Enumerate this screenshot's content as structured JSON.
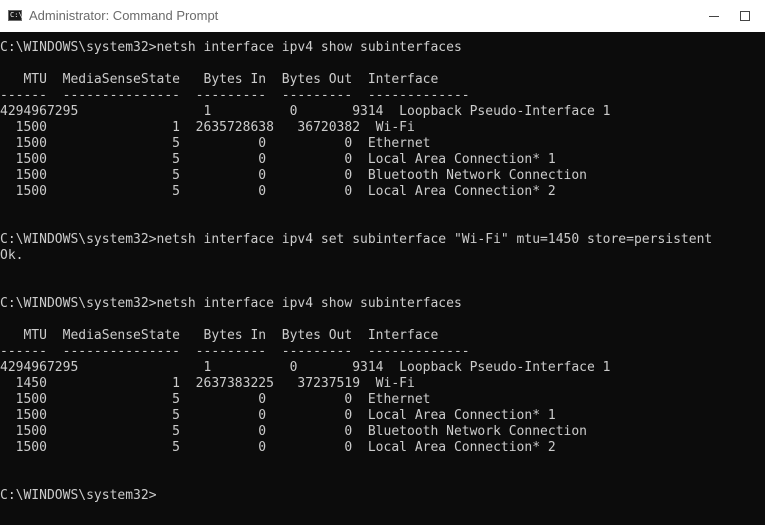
{
  "window": {
    "title": "Administrator: Command Prompt",
    "icon": "cmd-icon",
    "icon_glyph": "C:\\"
  },
  "colors": {
    "console_background": "#0c0c0c",
    "console_text": "#cccccc",
    "titlebar_background": "#ffffff",
    "title_text": "#6b6b6b"
  },
  "console": {
    "lines": [
      "C:\\WINDOWS\\system32>netsh interface ipv4 show subinterfaces",
      "",
      "   MTU  MediaSenseState   Bytes In  Bytes Out  Interface",
      "------  ---------------  ---------  ---------  -------------",
      "4294967295                1          0       9314  Loopback Pseudo-Interface 1",
      "  1500                1  2635728638   36720382  Wi-Fi",
      "  1500                5          0          0  Ethernet",
      "  1500                5          0          0  Local Area Connection* 1",
      "  1500                5          0          0  Bluetooth Network Connection",
      "  1500                5          0          0  Local Area Connection* 2",
      "",
      "",
      "C:\\WINDOWS\\system32>netsh interface ipv4 set subinterface \"Wi-Fi\" mtu=1450 store=persistent",
      "Ok.",
      "",
      "",
      "C:\\WINDOWS\\system32>netsh interface ipv4 show subinterfaces",
      "",
      "   MTU  MediaSenseState   Bytes In  Bytes Out  Interface",
      "------  ---------------  ---------  ---------  -------------",
      "4294967295                1          0       9314  Loopback Pseudo-Interface 1",
      "  1450                1  2637383225   37237519  Wi-Fi",
      "  1500                5          0          0  Ethernet",
      "  1500                5          0          0  Local Area Connection* 1",
      "  1500                5          0          0  Bluetooth Network Connection",
      "  1500                5          0          0  Local Area Connection* 2",
      "",
      "",
      "C:\\WINDOWS\\system32>"
    ]
  }
}
